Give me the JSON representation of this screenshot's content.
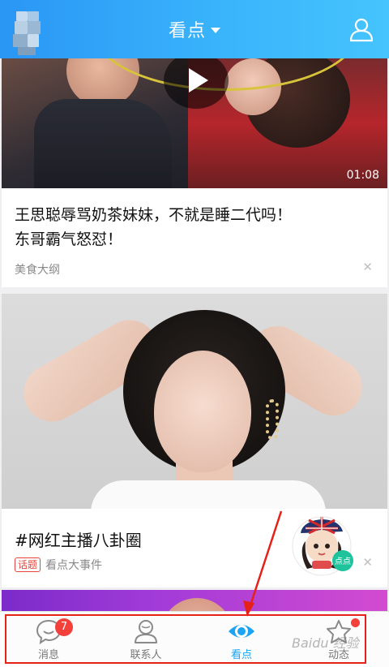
{
  "header": {
    "title": "看点",
    "accent_color": "#2a96f5",
    "profile_icon": "person-outline-icon"
  },
  "feed": [
    {
      "type": "video",
      "duration": "01:08",
      "headline_line1": "王思聪辱骂奶茶妹妹，不就是睡二代吗！",
      "headline_line2": "东哥霸气怒怼！",
      "source": "美食大纲"
    },
    {
      "type": "topic",
      "title": "#网红主播八卦圈",
      "tag": "话题",
      "source": "看点大事件"
    }
  ],
  "tabbar": {
    "tabs": [
      {
        "label": "消息",
        "icon": "chat-bubble-icon",
        "badge": "7"
      },
      {
        "label": "联系人",
        "icon": "contacts-icon"
      },
      {
        "label": "看点",
        "icon": "eye-icon",
        "active": true
      },
      {
        "label": "动态",
        "icon": "star-icon",
        "dot": true
      }
    ],
    "active_color": "#1aa4f3"
  },
  "watermark": "Baidu 经验"
}
